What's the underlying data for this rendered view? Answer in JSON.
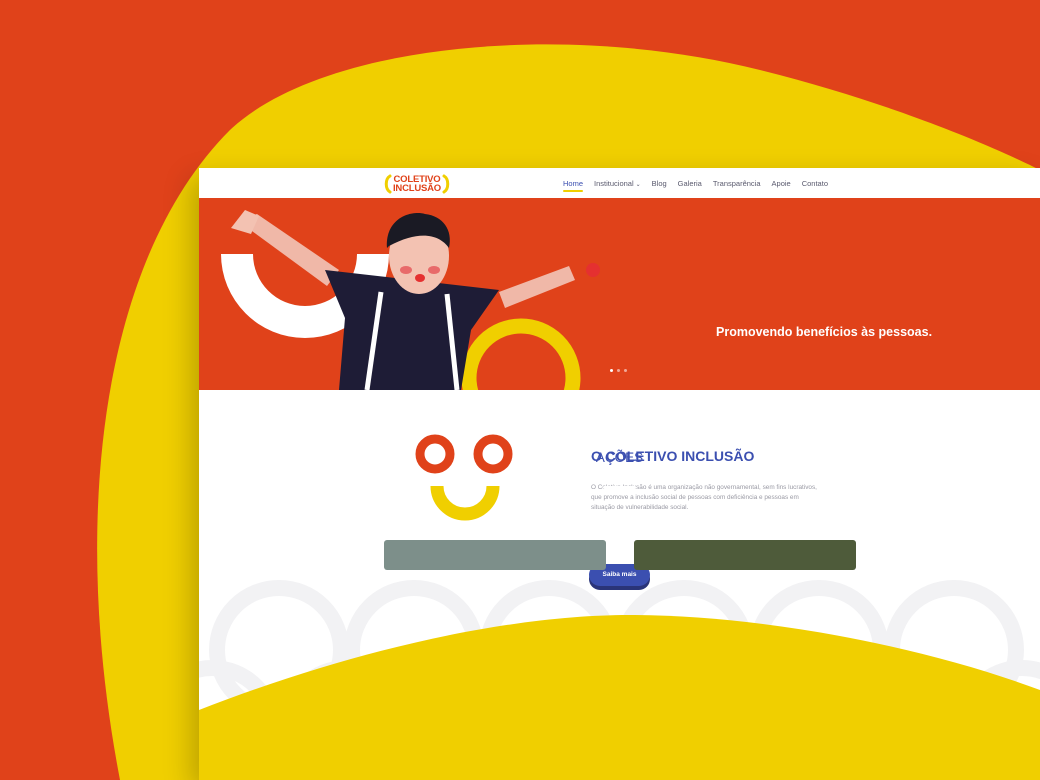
{
  "colors": {
    "brand_orange": "#e0421a",
    "brand_yellow": "#f0cf00",
    "brand_blue": "#3b4fb0",
    "white": "#ffffff"
  },
  "header": {
    "logo_line1": "COLETIVO",
    "logo_line2": "INCLUSÃO",
    "nav": {
      "home": "Home",
      "institucional": "Institucional",
      "blog": "Blog",
      "galeria": "Galeria",
      "transparencia": "Transparência",
      "apoie": "Apoie",
      "contato": "Contato"
    },
    "active_item": "Home"
  },
  "hero": {
    "headline": "Promovendo benefícios às pessoas.",
    "slide_count": 3,
    "active_slide": 1
  },
  "about": {
    "title": "O COLETIVO INCLUSÃO",
    "text": "O Coletivo Inclusão é uma organização não governamental, sem fins lucrativos, que promove  a inclusão social de pessoas com deficiência e pessoas em situação de vulnerabilidade social.",
    "button_label": "Saiba mais"
  },
  "acoes": {
    "title": "AÇÕES"
  },
  "icons": {
    "caret": "chevron-down-icon",
    "smiley": "smiley-logo-icon"
  }
}
